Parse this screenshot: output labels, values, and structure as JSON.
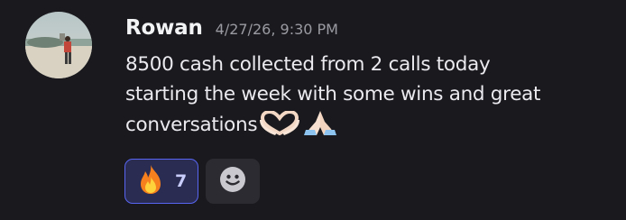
{
  "message": {
    "author": "Rowan",
    "timestamp": "4/27/26, 9:30 PM",
    "lines": [
      "8500 cash collected from 2 calls today",
      "starting the week with some wins and great",
      "conversations"
    ],
    "inline_emojis": [
      "heart-hands",
      "folded-hands"
    ]
  },
  "reactions": [
    {
      "emoji": "fire",
      "count": "7",
      "active": true
    }
  ],
  "add_reaction_icon": "smiley-icon",
  "colors": {
    "background": "#1a1a1e",
    "reaction_active_bg": "#2a2c52",
    "reaction_active_border": "#5865f2"
  }
}
